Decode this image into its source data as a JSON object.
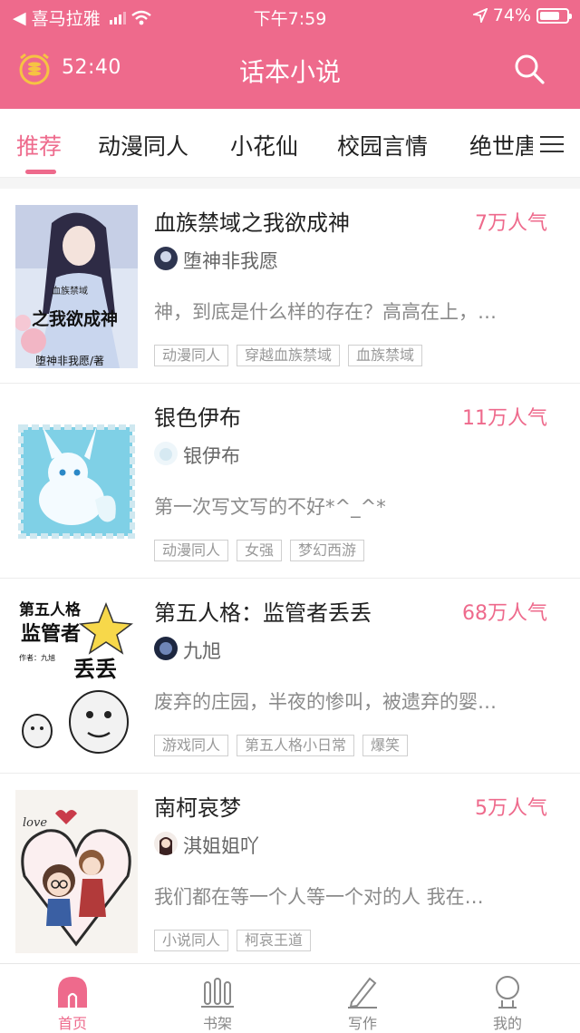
{
  "status_bar": {
    "carrier": "喜马拉雅",
    "time": "下午7:59",
    "battery": "74%",
    "battery_level": 0.74
  },
  "header": {
    "timer": "52:40",
    "title": "话本小说",
    "icons": [
      "alarm-clock-icon",
      "search-icon"
    ]
  },
  "tabs": [
    {
      "label": "推荐",
      "active": true
    },
    {
      "label": "动漫同人",
      "active": false
    },
    {
      "label": "小花仙",
      "active": false
    },
    {
      "label": "校园言情",
      "active": false
    },
    {
      "label": "绝世唐",
      "active": false
    }
  ],
  "books": [
    {
      "title": "血族禁域之我欲成神",
      "popularity": "7万人气",
      "author": "堕神非我愿",
      "description": "神，到底是什么样的存在？高高在上，…",
      "tags": [
        "动漫同人",
        "穿越血族禁域",
        "血族禁域"
      ],
      "cover_text": {
        "top": "血族禁域",
        "main": "之我欲成神",
        "bottom": "堕神非我愿/著"
      }
    },
    {
      "title": "银色伊布",
      "popularity": "11万人气",
      "author": "银伊布",
      "description": "第一次写文写的不好*^_^*",
      "tags": [
        "动漫同人",
        "女强",
        "梦幻西游"
      ]
    },
    {
      "title": "第五人格：监管者丢丢",
      "popularity": "68万人气",
      "author": "九旭",
      "description": "废弃的庄园，半夜的惨叫，被遗弃的婴…",
      "tags": [
        "游戏同人",
        "第五人格小日常",
        "爆笑"
      ],
      "cover_text": {
        "line1": "第五人格",
        "line2": "监管者",
        "line3": "丢丢",
        "credit": "作者：九旭"
      }
    },
    {
      "title": "南柯哀梦",
      "popularity": "5万人气",
      "author": "淇姐姐吖",
      "description": "我们都在等一个人等一个对的人  我在…",
      "tags": [
        "小说同人",
        "柯哀王道"
      ],
      "cover_text": {
        "love": "love"
      }
    }
  ],
  "bottom_nav": [
    {
      "label": "首页",
      "icon": "home-icon",
      "active": true
    },
    {
      "label": "书架",
      "icon": "bookshelf-icon",
      "active": false
    },
    {
      "label": "写作",
      "icon": "pen-icon",
      "active": false
    },
    {
      "label": "我的",
      "icon": "profile-icon",
      "active": false
    }
  ],
  "colors": {
    "accent": "#ee6a8c",
    "text": "#222222",
    "muted": "#8a8a8a"
  }
}
